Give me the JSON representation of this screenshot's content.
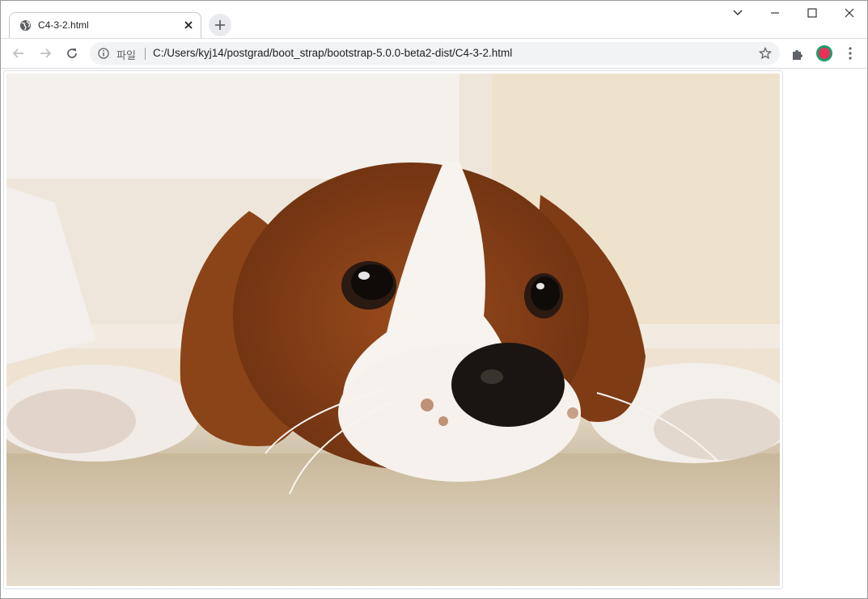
{
  "browser": {
    "tab": {
      "title": "C4-3-2.html",
      "favicon": "globe-icon"
    },
    "address": {
      "scheme_label": "파일",
      "url": "C:/Users/kyj14/postgrad/boot_strap/bootstrap-5.0.0-beta2-dist/C4-3-2.html"
    }
  },
  "content": {
    "image": {
      "subject": "dog-photo"
    }
  },
  "colors": {
    "accent_profile_outer": "#1a9e6a",
    "accent_profile_inner": "#e8305a",
    "omnibox_bg": "#f1f3f4"
  }
}
